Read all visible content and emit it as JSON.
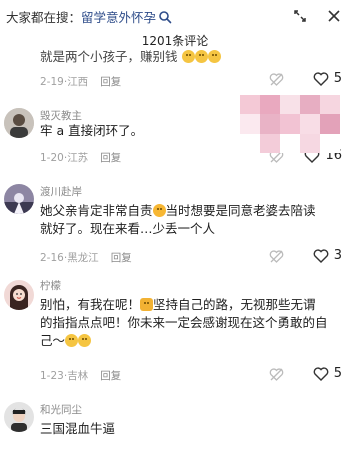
{
  "topbar": {
    "search_prefix": "大家都在搜：",
    "search_term": "留学意外怀孕"
  },
  "header": {
    "title": "1201条评论"
  },
  "comments": [
    {
      "user": "",
      "text": "就是两个小孩子，赚别钱",
      "date": "2-19",
      "location": "江西",
      "reply": "回复",
      "likes": "5"
    },
    {
      "user": "毁灭教主",
      "text": "牢 a 直接闭环了。",
      "date": "1-20",
      "location": "江苏",
      "reply": "回复",
      "likes": "16"
    },
    {
      "user": "渡川赴岸",
      "text_line1": "她父亲肯定非常自责",
      "text_line1b": "当时想要是同意老婆去陪读",
      "text_line2": "就好了。现在来看…少丢一个人",
      "date": "2-16",
      "location": "黑龙江",
      "reply": "回复",
      "likes": "3"
    },
    {
      "user": "柠檬",
      "text_line1a": "别怕，有我在呢！",
      "text_line1b": "坚持自己的路，无视那些无谓",
      "text_line2": "的指指点点吧！你未来一定会感谢现在这个勇敢的自",
      "text_line3": "己～",
      "date": "1-23",
      "location": "吉林",
      "reply": "回复",
      "likes": "5"
    },
    {
      "user": "和光同尘",
      "text": "三国混血牛逼"
    }
  ],
  "colors": {
    "accent": "#2f4d8a",
    "meta": "#a0a0a0",
    "text": "#1e1e1e"
  }
}
